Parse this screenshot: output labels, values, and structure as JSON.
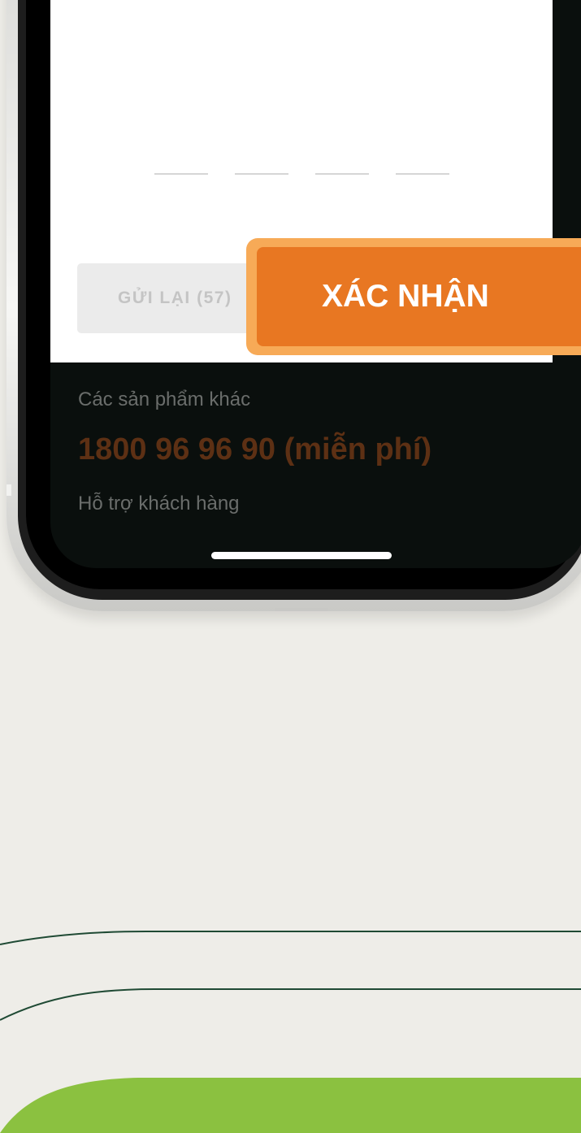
{
  "otp": {
    "slot_count": 4
  },
  "buttons": {
    "resend_label": "GỬI LẠI (57)",
    "confirm_label": "XÁC NHẬN"
  },
  "footer": {
    "other_products": "Các sản phẩm khác",
    "hotline": "1800 96 96 90 (miễn phí)",
    "support": "Hỗ trợ khách hàng"
  },
  "colors": {
    "accent_orange": "#e87722",
    "highlight_orange": "#f7aa57",
    "page_background": "#eeede8",
    "screen_dark": "#0a0f0d",
    "brand_green": "#8bc140",
    "line_dark_green": "#1f4a34"
  }
}
